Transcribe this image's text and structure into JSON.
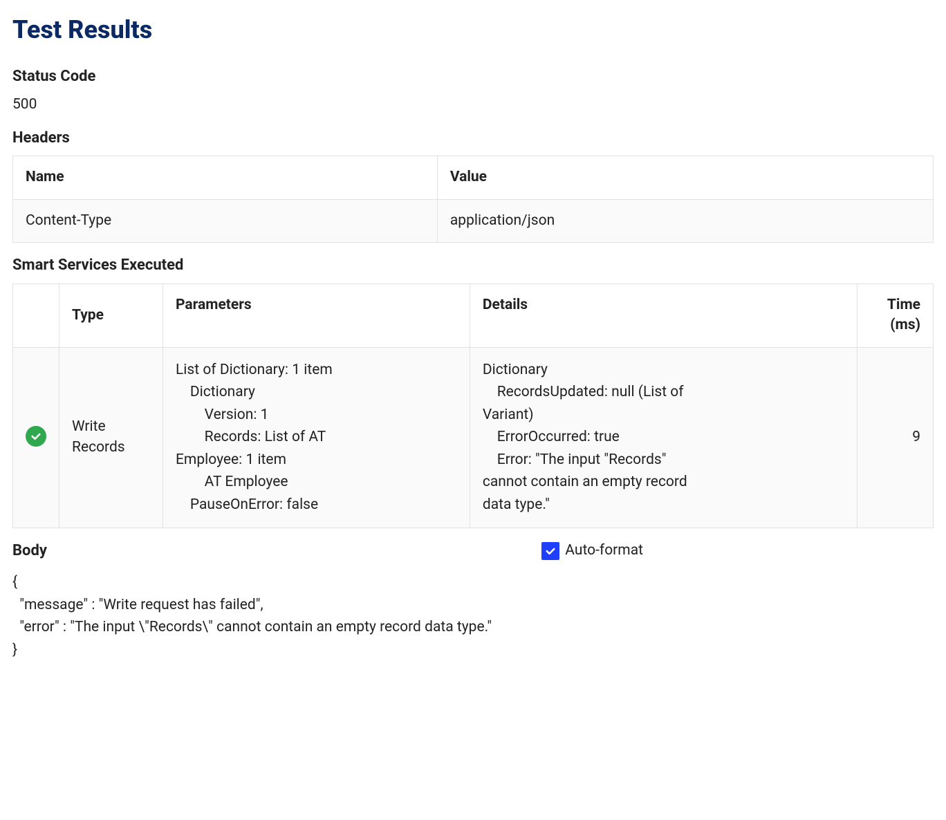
{
  "title": "Test Results",
  "status_code": {
    "label": "Status Code",
    "value": "500"
  },
  "headers": {
    "label": "Headers",
    "columns": {
      "name": "Name",
      "value": "Value"
    },
    "rows": [
      {
        "name": "Content-Type",
        "value": "application/json"
      }
    ]
  },
  "services": {
    "label": "Smart Services Executed",
    "columns": {
      "status": "",
      "type": "Type",
      "params": "Parameters",
      "details": "Details",
      "time": "Time (ms)"
    },
    "rows": [
      {
        "status_icon": "check-circle-icon",
        "type": "Write Records",
        "parameters": "List of Dictionary: 1 item\n    Dictionary\n        Version: 1\n        Records: List of AT\nEmployee: 1 item\n        AT Employee\n    PauseOnError: false",
        "details": "Dictionary\n    RecordsUpdated: null (List of\nVariant)\n    ErrorOccurred: true\n    Error: \"The input \"Records\"\ncannot contain an empty record\ndata type.\"",
        "time_ms": "9"
      }
    ]
  },
  "body": {
    "label": "Body",
    "autoformat_label": "Auto-format",
    "autoformat_checked": true,
    "content": "{\n  \"message\" : \"Write request has failed\",\n  \"error\" : \"The input \\\"Records\\\" cannot contain an empty record data type.\"\n}"
  }
}
